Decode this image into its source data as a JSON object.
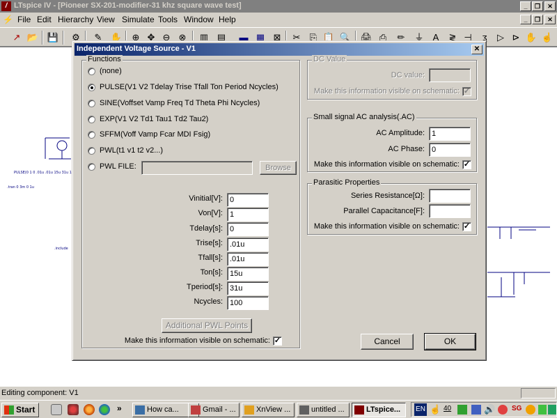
{
  "window": {
    "title": "LTspice IV - [Pioneer SX-201-modifier-31 khz square wave test]",
    "controls": [
      "_",
      "❐",
      "✕"
    ],
    "child_controls": [
      "_",
      "❐",
      "✕"
    ]
  },
  "menu": [
    "File",
    "Edit",
    "Hierarchy",
    "View",
    "Simulate",
    "Tools",
    "Window",
    "Help"
  ],
  "dialog": {
    "title": "Independent Voltage Source - V1",
    "close": "✕",
    "functions": {
      "label": "Functions",
      "options": [
        {
          "label": "(none)",
          "checked": false
        },
        {
          "label": "PULSE(V1 V2 Tdelay Trise Tfall Ton Period Ncycles)",
          "checked": true
        },
        {
          "label": "SINE(Voffset Vamp Freq Td Theta Phi Ncycles)",
          "checked": false
        },
        {
          "label": "EXP(V1 V2 Td1 Tau1 Td2 Tau2)",
          "checked": false
        },
        {
          "label": "SFFM(Voff Vamp Fcar MDI Fsig)",
          "checked": false
        },
        {
          "label": "PWL(t1 v1 t2 v2...)",
          "checked": false
        },
        {
          "label": "PWL FILE:",
          "checked": false
        }
      ],
      "pwl_file_value": "",
      "browse_label": "Browse",
      "params": [
        {
          "label": "Vinitial[V]:",
          "value": "0"
        },
        {
          "label": "Von[V]:",
          "value": "1"
        },
        {
          "label": "Tdelay[s]:",
          "value": "0"
        },
        {
          "label": "Trise[s]:",
          "value": ".01u"
        },
        {
          "label": "Tfall[s]:",
          "value": ".01u"
        },
        {
          "label": "Ton[s]:",
          "value": "15u"
        },
        {
          "label": "Tperiod[s]:",
          "value": "31u"
        },
        {
          "label": "Ncycles:",
          "value": "100"
        }
      ],
      "additional_pwl_label": "Additional PWL Points",
      "visible_label": "Make this information visible on schematic:",
      "visible_checked": "✓"
    },
    "dc": {
      "label": "DC Value",
      "value_label": "DC value:",
      "value": "",
      "visible_label": "Make this information visible on schematic:",
      "visible_checked": "✓"
    },
    "ac": {
      "label": "Small signal AC analysis(.AC)",
      "amplitude_label": "AC Amplitude:",
      "amplitude": "1",
      "phase_label": "AC Phase:",
      "phase": "0",
      "visible_label": "Make this information visible on schematic:",
      "visible_checked": "✓"
    },
    "parasitic": {
      "label": "Parasitic Properties",
      "series_label": "Series Resistance[Ω]:",
      "series": "",
      "parallel_label": "Parallel Capacitance[F]:",
      "parallel": "",
      "visible_label": "Make this information visible on schematic:",
      "visible_checked": "✓"
    },
    "cancel_label": "Cancel",
    "ok_label": "OK"
  },
  "status": "Editing component: V1",
  "taskbar": {
    "start": "Start",
    "tasks": [
      "How ca...",
      "Gmail - ...",
      "XnView ...",
      "untitled ...",
      "LTspice..."
    ],
    "lang": "EN",
    "tray_text": "40"
  },
  "colors": {
    "title_active": "#0a246a",
    "title_inactive": "#808080",
    "schematic_wire": "#000080"
  }
}
